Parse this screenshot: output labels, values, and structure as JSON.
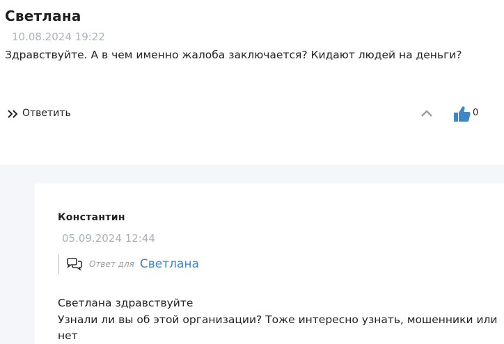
{
  "main_comment": {
    "author": "Светлана",
    "date": "10.08.2024 19:22",
    "text": "Здравствуйте. А в чем именно жалоба заключается? Кидают людей на деньги?",
    "reply_label": "Ответить",
    "likes": "0",
    "icons": [
      "double-chevron-right-icon",
      "chevron-up-icon",
      "thumbs-up-icon"
    ]
  },
  "reply": {
    "author": "Константин",
    "date": "05.09.2024 12:44",
    "reply_for_label": "Ответ для",
    "reply_to_name": "Светлана",
    "text_lines": [
      "Светлана здравствуйте",
      "Узнали ли вы об этой организации? Тоже интересно узнать, мошенники или",
      "нет"
    ],
    "icons": [
      "chat-bubbles-icon"
    ]
  },
  "colors": {
    "accent_blue": "#3f86c7",
    "like_blue": "#3f86c7",
    "muted_date": "#a9b2bd",
    "replies_background": "#f5f6f9"
  }
}
